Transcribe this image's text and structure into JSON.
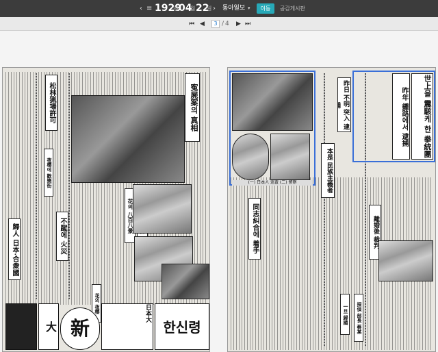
{
  "toolbar": {
    "prev_arrow": "‹",
    "menu_icon": "≡",
    "year": "1929",
    "year_unit": "년",
    "month": "04",
    "month_unit": "월",
    "day": "22",
    "day_unit": "일",
    "next_arrow": "›",
    "newspaper": "동아일보",
    "go_button": "이동",
    "notice_link": "공감게시판"
  },
  "pager": {
    "first": "⏮",
    "prev": "◀",
    "current": "3",
    "separator": "/",
    "total": "4",
    "next": "▶",
    "last": "⏭"
  },
  "page_left": {
    "headlines": [
      "寃屍案의 真相",
      "松林猟場許可",
      "夜櫻·人波·大醉",
      "花의 八百八景",
      "歸人 日本·合衆國",
      "不蹴에 火災",
      "夜櫻에 歡樂街",
      "花의 夜櫻"
    ],
    "ad_texts": [
      "한신령",
      "大",
      "新",
      "日本大"
    ]
  },
  "page_right": {
    "headlines": [
      "世上을 震駭케 한 拳統團",
      "昨年 鍾路에서 逮捕",
      "同志糾合에 着手",
      "離婚後 裁判",
      "昨日 不明 突入 逮捕",
      "本是 民族主義者",
      "一旦 歸國",
      "探偵 部長 蔡某"
    ],
    "photo_caption": "(一) 日本人 巡査 (二) 警察"
  }
}
